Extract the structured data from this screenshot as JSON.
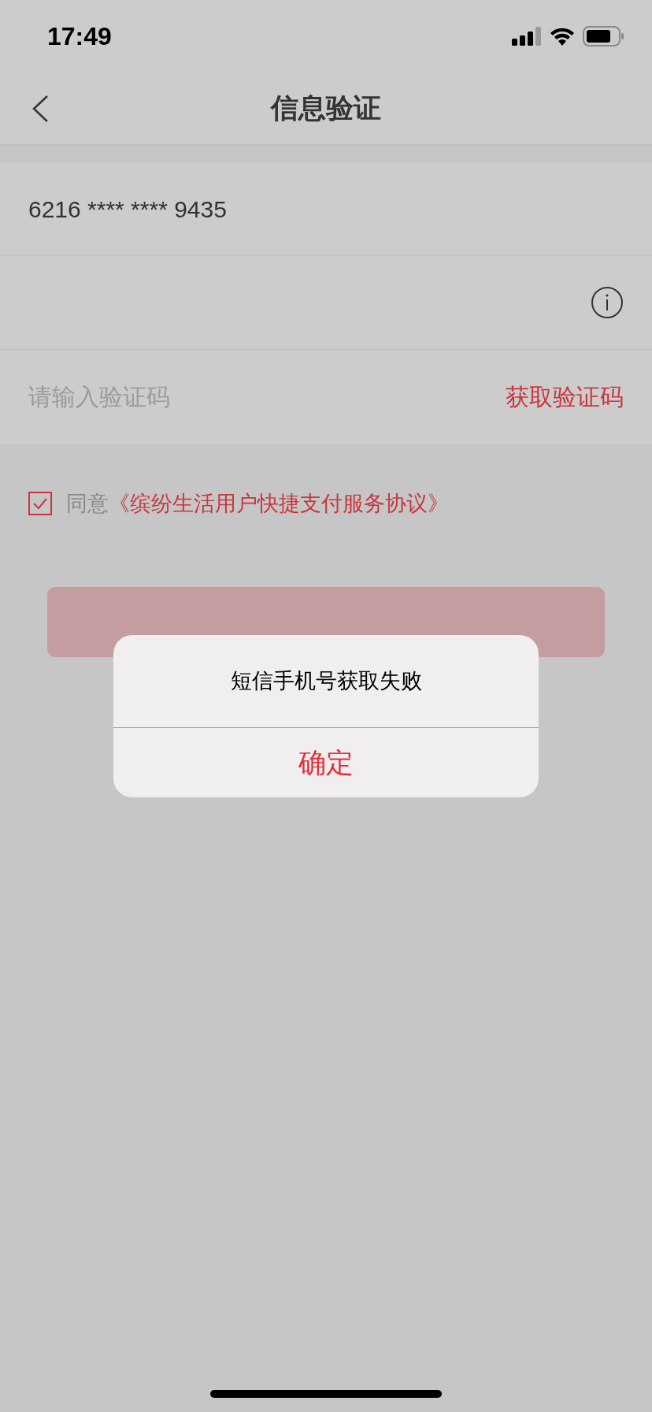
{
  "status_bar": {
    "time": "17:49"
  },
  "nav": {
    "title": "信息验证"
  },
  "form": {
    "card_number": "6216 **** **** 9435",
    "code_field": {
      "placeholder": "请输入验证码"
    },
    "get_code_button": "获取验证码"
  },
  "agreement": {
    "checked": true,
    "prefix": "同意",
    "link": "《缤纷生活用户快捷支付服务协议》"
  },
  "confirm_button": {
    "disabled": true
  },
  "alert": {
    "message": "短信手机号获取失败",
    "button": "确定"
  }
}
